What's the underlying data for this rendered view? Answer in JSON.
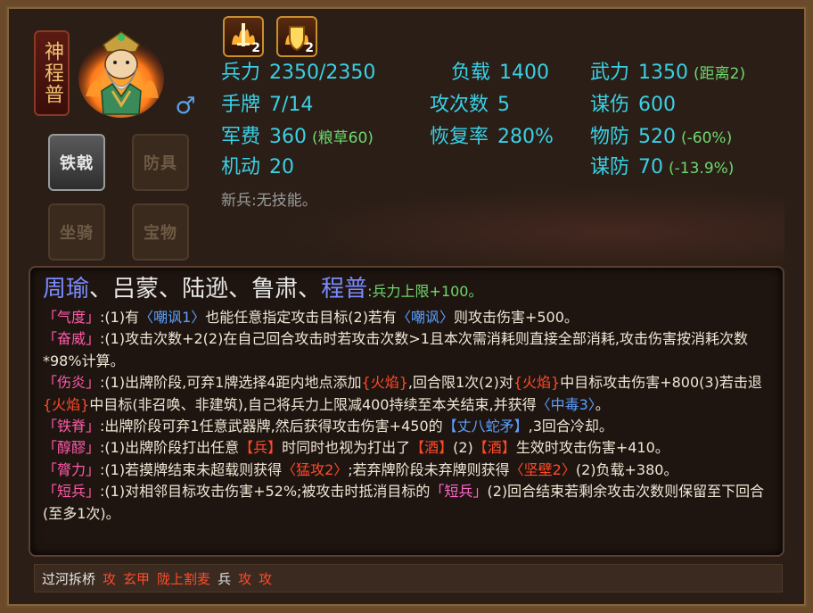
{
  "hero": {
    "name": "神程普",
    "gender_icon": "male-symbol-icon",
    "portrait_icon": "hero-portrait-icon"
  },
  "equipment_slots": [
    {
      "label": "铁戟",
      "active": true
    },
    {
      "label": "防具",
      "active": false
    },
    {
      "label": "坐骑",
      "active": false
    },
    {
      "label": "宝物",
      "active": false
    }
  ],
  "skill_icons": [
    {
      "name": "sword-flame-icon",
      "level": "2"
    },
    {
      "name": "shield-flame-icon",
      "level": "2"
    }
  ],
  "stats": {
    "bingli": {
      "label": "兵力",
      "value": "2350/2350"
    },
    "fuzai": {
      "label": "负载",
      "value": "1400"
    },
    "wuli": {
      "label": "武力",
      "value": "1350",
      "note": "(距离2)"
    },
    "shoupai": {
      "label": "手牌",
      "value": "7/14"
    },
    "gongcishu": {
      "label": "攻次数",
      "value": "5"
    },
    "moushang": {
      "label": "谋伤",
      "value": "600"
    },
    "junfei": {
      "label": "军费",
      "value": "360",
      "note": "(粮草60)"
    },
    "huifulv": {
      "label": "恢复率",
      "value": "280%"
    },
    "wufang": {
      "label": "物防",
      "value": "520",
      "note": "(-60%)"
    },
    "jidong": {
      "label": "机动",
      "value": "20"
    },
    "moufang": {
      "label": "谋防",
      "value": "70",
      "note": "(-13.9%)"
    }
  },
  "new_soldier": "新兵:无技能。",
  "panel": {
    "title_blue1": "周瑜",
    "sep": "、",
    "title_white1": "吕蒙",
    "title_white2": "陆逊",
    "title_white3": "鲁肃",
    "title_blue2": "程普",
    "title_note": ":兵力上限+100。"
  },
  "skills": [
    {
      "name": "「气度」",
      "parts": [
        ":(1)有",
        "〈嘲讽1〉",
        "也能任意指定攻击目标(2)若有",
        "〈嘲讽〉",
        "则攻击伤害+500。"
      ]
    },
    {
      "name": "「奋威」",
      "parts": [
        ":(1)攻击次数+2(2)在自己回合攻击时若攻击次数>1且本次需消耗则直接全部消耗,攻击伤害按消耗次数*98%计算。"
      ]
    },
    {
      "name": "「伤炎」",
      "parts": [
        ":(1)出牌阶段,可弃1牌选择4距内地点添加",
        "{火焰}",
        ",回合限1次(2)对",
        "{火焰}",
        "中目标攻击伤害+800(3)若击退",
        "{火焰}",
        "中目标(非召唤、非建筑),自己将兵力上限减400持续至本关结束,并获得",
        "〈中毒3〉",
        "。"
      ]
    },
    {
      "name": "「铁脊」",
      "parts": [
        ":出牌阶段可弃1任意武器牌,然后获得攻击伤害+450的",
        "【丈八蛇矛】",
        ",3回合冷却。"
      ]
    },
    {
      "name": "「醇醪」",
      "parts": [
        ":(1)出牌阶段打出任意",
        "【兵】",
        "时同时也视为打出了",
        "【酒】",
        "(2)",
        "【酒】",
        "生效时攻击伤害+410。"
      ]
    },
    {
      "name": "「膂力」",
      "parts": [
        ":(1)若摸牌结束未超载则获得",
        "〈猛攻2〉",
        ";若弃牌阶段未弃牌则获得",
        "〈坚壁2〉",
        "(2)负载+380。"
      ]
    },
    {
      "name": "「短兵」",
      "parts": [
        ":(1)对相邻目标攻击伤害+52%;被攻击时抵消目标的",
        "「短兵」",
        "(2)回合结束若剩余攻击次数则保留至下回合(至多1次)。"
      ]
    }
  ],
  "footer": [
    {
      "text": "过河拆桥",
      "color": "white"
    },
    {
      "text": "攻",
      "color": "red"
    },
    {
      "text": "玄甲",
      "color": "red"
    },
    {
      "text": "陇上割麦",
      "color": "red"
    },
    {
      "text": "兵",
      "color": "white"
    },
    {
      "text": "攻",
      "color": "red"
    },
    {
      "text": "攻",
      "color": "red"
    }
  ]
}
